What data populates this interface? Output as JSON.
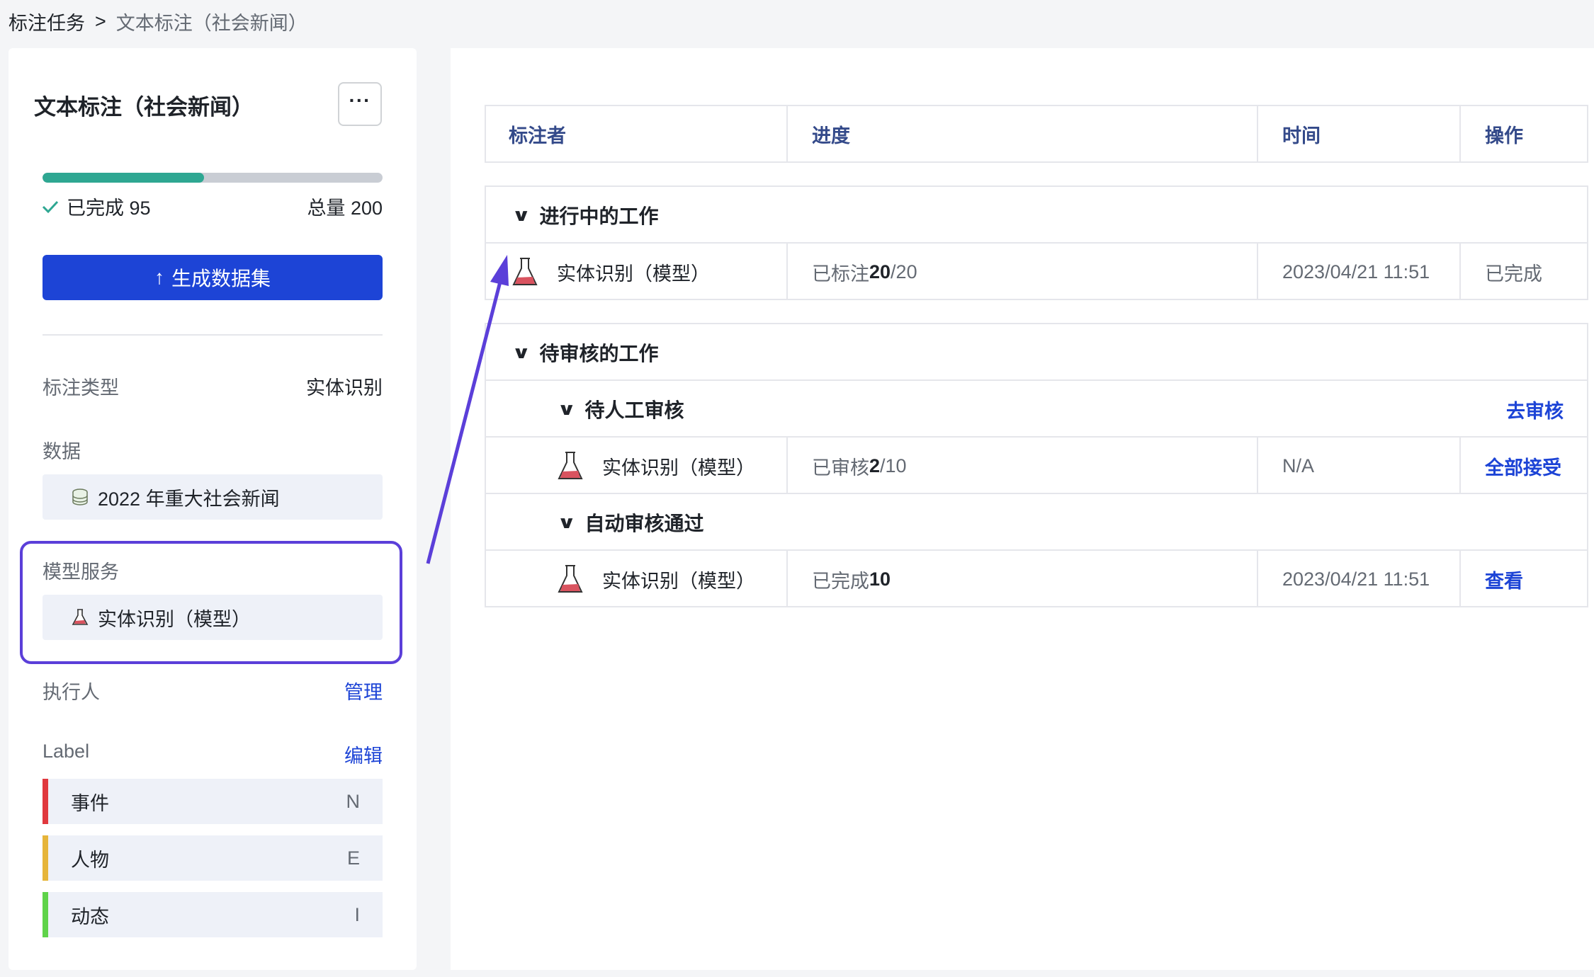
{
  "breadcrumb": {
    "root": "标注任务",
    "separator": ">",
    "current": "文本标注（社会新闻）"
  },
  "task": {
    "title": "文本标注（社会新闻）",
    "more_label": "···",
    "progress": {
      "completed": 95,
      "total": 200,
      "completed_label": "已完成 95",
      "total_label": "总量 200"
    },
    "generate_button": "生成数据集",
    "annotation_type": {
      "label": "标注类型",
      "value": "实体识别"
    },
    "data": {
      "label": "数据",
      "value": "2022 年重大社会新闻"
    },
    "model_service": {
      "label": "模型服务",
      "value": "实体识别（模型）"
    },
    "executor": {
      "label": "执行人",
      "action": "管理"
    },
    "labels": {
      "title": "Label",
      "action": "编辑",
      "items": [
        {
          "name": "事件",
          "key": "N",
          "color": "#e0383e"
        },
        {
          "name": "人物",
          "key": "E",
          "color": "#e6b53a"
        },
        {
          "name": "动态",
          "key": "I",
          "color": "#5fd34a"
        }
      ]
    }
  },
  "table": {
    "headers": [
      "标注者",
      "进度",
      "时间",
      "操作"
    ],
    "in_progress": {
      "title": "进行中的工作",
      "row": {
        "annotator": "实体识别（模型）",
        "progress_prefix": "已标注 ",
        "progress_value": "20",
        "progress_suffix": "/20",
        "time": "2023/04/21 11:51",
        "action": "已完成"
      }
    },
    "pending_review": {
      "title": "待审核的工作",
      "manual": {
        "title": "待人工审核",
        "action": "去审核",
        "row": {
          "annotator": "实体识别（模型）",
          "progress_prefix": "已审核 ",
          "progress_value": "2",
          "progress_suffix": "/10",
          "time": "N/A",
          "action": "全部接受"
        }
      },
      "auto": {
        "title": "自动审核通过",
        "row": {
          "annotator": "实体识别（模型）",
          "progress_prefix": "已完成 ",
          "progress_value": "10",
          "progress_suffix": "",
          "time": "2023/04/21 11:51",
          "action": "查看"
        }
      }
    }
  },
  "colors": {
    "primary": "#1d44d6",
    "progress": "#2ea792",
    "highlight": "#5b3fd9",
    "header_text": "#344a8a"
  },
  "icons": [
    "check-icon",
    "upload-icon",
    "database-icon",
    "flask-icon",
    "chevron-down-icon",
    "more-icon"
  ]
}
